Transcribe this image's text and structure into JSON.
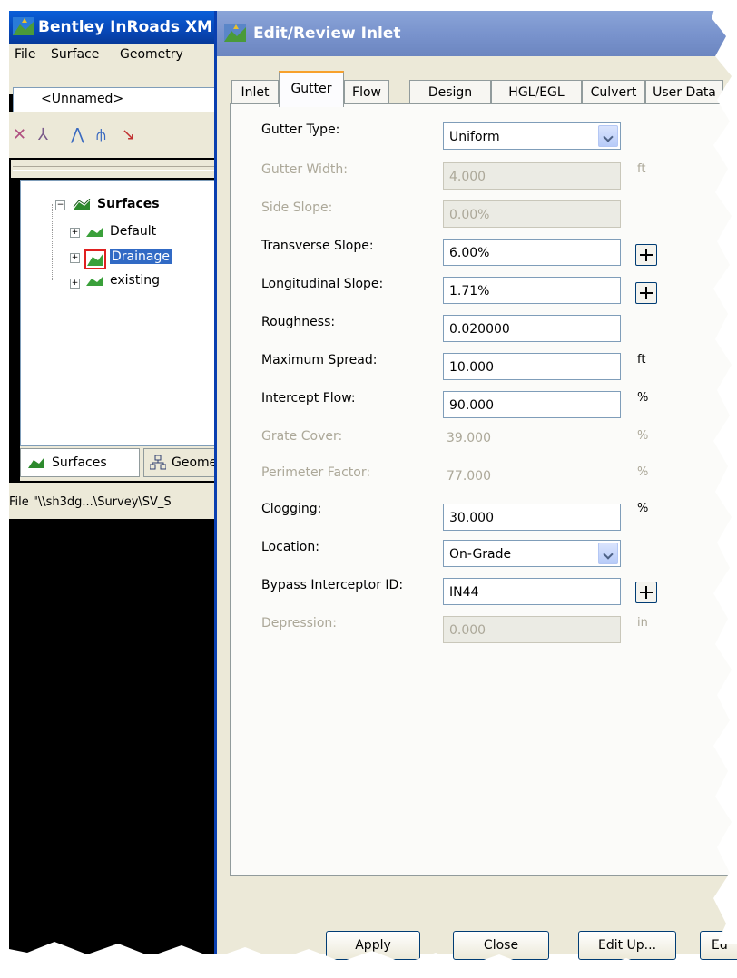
{
  "bg_window": {
    "title": "Bentley InRoads XM",
    "menu": [
      {
        "label": "File",
        "mnemonic": "F"
      },
      {
        "label": "Surface",
        "mnemonic": "S"
      },
      {
        "label": "Geometry",
        "mnemonic": "G"
      }
    ],
    "project_combo": "<Unnamed>",
    "tree": {
      "root": "Surfaces",
      "items": [
        "Default",
        "Drainage",
        "existing"
      ],
      "selected": "Drainage"
    },
    "tabs": [
      "Surfaces",
      "Geometry"
    ],
    "status": "File \"\\\\sh3dg...\\Survey\\SV_S"
  },
  "dialog": {
    "title": "Edit/Review Inlet",
    "tabs": [
      "Inlet",
      "Gutter",
      "Flow",
      "Design",
      "HGL/EGL",
      "Culvert",
      "User Data"
    ],
    "active_tab": "Gutter",
    "fields": {
      "gutter_type": {
        "label": "Gutter Type:",
        "value": "Uniform"
      },
      "gutter_width": {
        "label": "Gutter Width:",
        "value": "4.000",
        "unit": "ft"
      },
      "side_slope": {
        "label": "Side Slope:",
        "value": "0.00%"
      },
      "transverse_slope": {
        "label": "Transverse Slope:",
        "value": "6.00%"
      },
      "longitudinal_slope": {
        "label": "Longitudinal Slope:",
        "value": "1.71%"
      },
      "roughness": {
        "label": "Roughness:",
        "value": "0.020000"
      },
      "maximum_spread": {
        "label": "Maximum Spread:",
        "value": "10.000",
        "unit": "ft"
      },
      "intercept_flow": {
        "label": "Intercept Flow:",
        "value": "90.000",
        "unit": "%"
      },
      "grate_cover": {
        "label": "Grate Cover:",
        "value": "39.000",
        "unit": "%"
      },
      "perimeter_factor": {
        "label": "Perimeter Factor:",
        "value": "77.000",
        "unit": "%"
      },
      "clogging": {
        "label": "Clogging:",
        "value": "30.000",
        "unit": "%"
      },
      "location": {
        "label": "Location:",
        "value": "On-Grade"
      },
      "bypass_interceptor_id": {
        "label": "Bypass Interceptor ID:",
        "value": "IN44"
      },
      "depression": {
        "label": "Depression:",
        "value": "0.000",
        "unit": "in"
      }
    },
    "buttons": [
      "Apply",
      "Close",
      "Edit Up...",
      "Ed"
    ]
  }
}
